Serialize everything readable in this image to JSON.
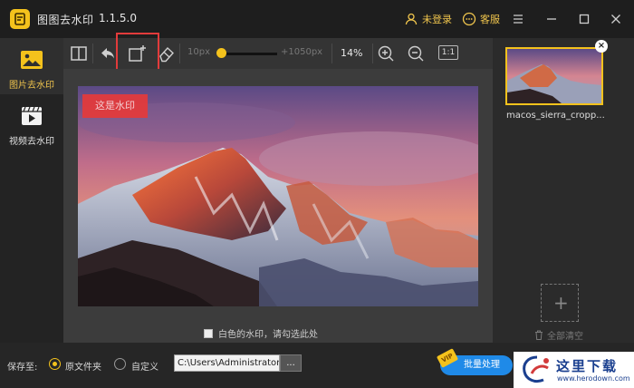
{
  "app": {
    "name": "图图去水印",
    "version": "1.1.5.0",
    "login_label": "未登录",
    "support_label": "客服"
  },
  "nav": {
    "items": [
      {
        "label": "图片去水印",
        "icon": "image-icon",
        "active": true
      },
      {
        "label": "视频去水印",
        "icon": "video-icon",
        "active": false
      }
    ]
  },
  "toolbar": {
    "brush_min": "10px",
    "brush_max": "+1050px",
    "brush_level_fraction": 0.02,
    "zoom": "14%",
    "ratio_label": "1:1",
    "tools": [
      "split-view-icon",
      "undo-icon",
      "rect-select-icon",
      "eraser-icon",
      "zoom-in-icon",
      "zoom-out-icon"
    ]
  },
  "canvas": {
    "watermark_text": "这是水印",
    "white_watermark_hint": "白色的水印，请勾选此处"
  },
  "files": {
    "items": [
      {
        "name": "macos_sierra_cropp..."
      }
    ],
    "add_label": "+",
    "clear_all_label": "全部清空"
  },
  "bottom": {
    "save_to_label": "保存至:",
    "option_original": "原文件夹",
    "option_custom": "自定义",
    "path_value": "C:\\Users\\Administrator",
    "browse_label": "...",
    "vip_badge": "VIP",
    "batch_label": "批量处理"
  },
  "watermark_site": {
    "name": "这里下载",
    "url": "www.herodown.com"
  },
  "colors": {
    "accent": "#f4c21c",
    "primary_button": "#1f8ae8",
    "highlight_border": "#e23b3b",
    "watermark_label": "#e53a3a"
  }
}
